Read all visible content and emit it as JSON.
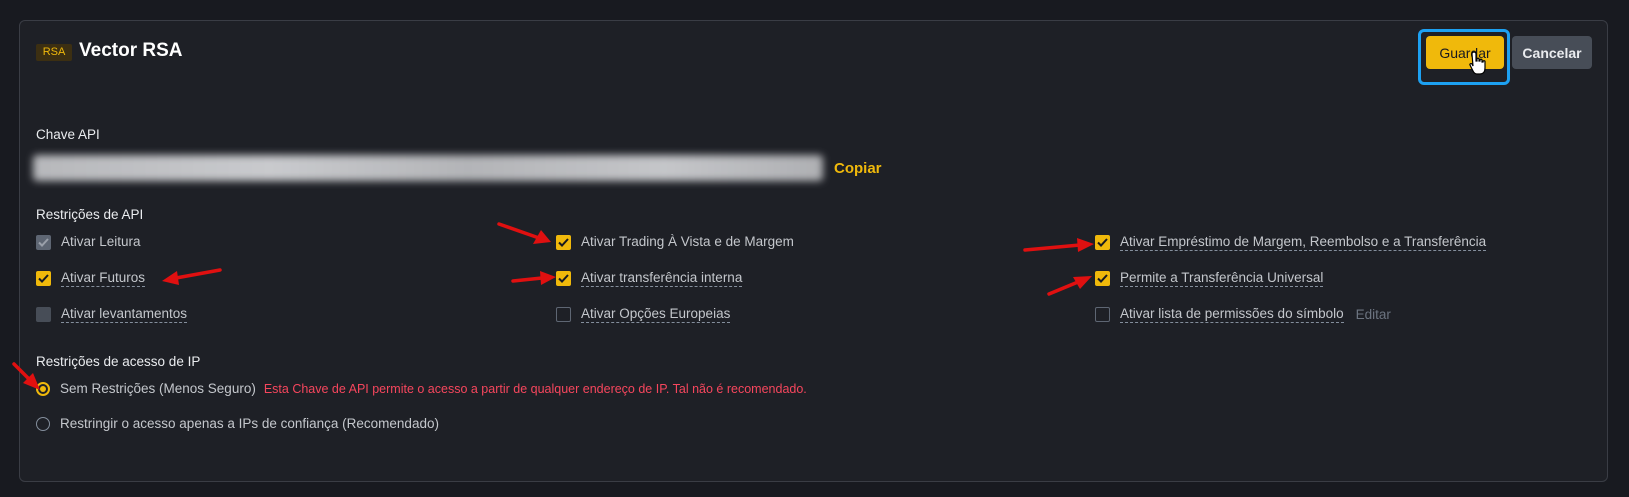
{
  "header": {
    "badge": "RSA",
    "title": "Vector RSA",
    "save_label": "Guardar",
    "cancel_label": "Cancelar"
  },
  "api_key": {
    "label": "Chave API",
    "copy_label": "Copiar"
  },
  "restrictions": {
    "label": "Restrições de API",
    "options": [
      {
        "label": "Ativar Leitura",
        "checked": true,
        "disabled": true
      },
      {
        "label": "Ativar Trading À Vista e de Margem",
        "checked": true
      },
      {
        "label": "Ativar Empréstimo de Margem, Reembolso e a Transferência",
        "checked": true
      },
      {
        "label": "Ativar Futuros",
        "checked": true
      },
      {
        "label": "Ativar transferência interna",
        "checked": true
      },
      {
        "label": "Permite a Transferência Universal",
        "checked": true
      },
      {
        "label": "Ativar levantamentos",
        "checked": false,
        "disabled": true
      },
      {
        "label": "Ativar Opções Europeias",
        "checked": false
      },
      {
        "label": "Ativar lista de permissões do símbolo",
        "checked": false
      }
    ],
    "edit_label": "Editar"
  },
  "ip": {
    "label": "Restrições de acesso de IP",
    "options": [
      {
        "label": "Sem Restrições (Menos Seguro)",
        "selected": true
      },
      {
        "label": "Restringir o acesso apenas a IPs de confiança (Recomendado)",
        "selected": false
      }
    ],
    "warning": "Esta Chave de API permite o acesso a partir de qualquer endereço de IP. Tal não é recomendado."
  },
  "colors": {
    "accent": "#f0b90b",
    "warning": "#f6465d",
    "highlight": "#1da1f2",
    "annotation": "#e01010"
  }
}
